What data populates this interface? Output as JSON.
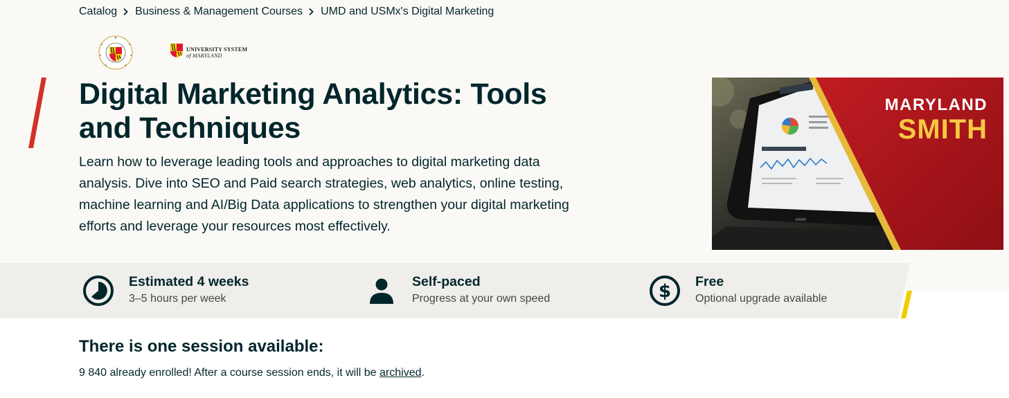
{
  "breadcrumb": {
    "items": [
      "Catalog",
      "Business & Management Courses",
      "UMD and USMx's Digital Marketing"
    ]
  },
  "logos": {
    "umd_alt": "University of Maryland",
    "usm_line1": "UNIVERSITY SYSTEM",
    "usm_line2": "of MARYLAND"
  },
  "course": {
    "title": "Digital Marketing Analytics: Tools and Techniques",
    "description": "Learn how to leverage leading tools and approaches to digital marketing data analysis. Dive into SEO and Paid search strategies, web analytics, online testing, machine learning and AI/Big Data applications to strengthen your digital marketing efforts and leverage your resources most effectively.",
    "image": {
      "line1": "MARYLAND",
      "line2": "SMITH"
    }
  },
  "stats": [
    {
      "icon": "clock-icon",
      "title": "Estimated 4 weeks",
      "sub": "3–5 hours per week"
    },
    {
      "icon": "person-icon",
      "title": "Self-paced",
      "sub": "Progress at your own speed"
    },
    {
      "icon": "dollar-icon",
      "title": "Free",
      "sub": "Optional upgrade available"
    }
  ],
  "session": {
    "title": "There is one session available:",
    "enrolled_text": "9 840 already enrolled! After a course session ends, it will be ",
    "archived_link": "archived",
    "period": "."
  },
  "colors": {
    "primary_text": "#00262b",
    "hero_bg": "#fbf9f6",
    "stats_bg": "#f0eeeb",
    "accent_red": "#d23228",
    "accent_yellow": "#f0cc00",
    "smith_red": "#b5161c",
    "smith_gold": "#f6c843"
  }
}
